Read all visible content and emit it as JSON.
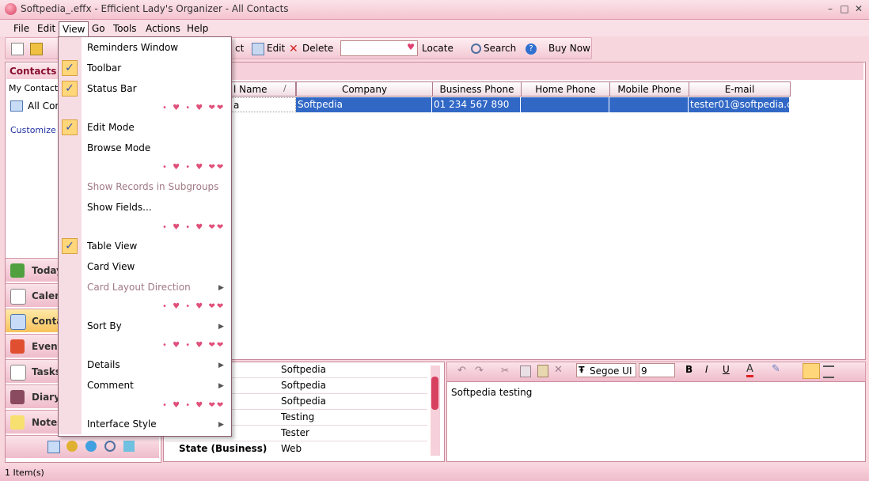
{
  "window": {
    "title": "Softpedia_.effx - Efficient Lady's Organizer - All Contacts",
    "minimize": "–",
    "maximize": "□",
    "close": "✕"
  },
  "menubar": [
    "File",
    "Edit",
    "View",
    "Go",
    "Tools",
    "Actions",
    "Help"
  ],
  "toolbar": {
    "contact_partial": "ct",
    "edit": "Edit",
    "delete": "Delete",
    "locate": "Locate",
    "search": "Search",
    "buy_now": "Buy Now"
  },
  "nav": {
    "title": "Contacts",
    "my_contacts": "My Contacts",
    "all_contacts": "All Con",
    "customize": "Customize C",
    "buttons": [
      "Today",
      "Calen",
      "Conta",
      "Event",
      "Tasks",
      "Diary",
      "Notes"
    ],
    "active": "Conta"
  },
  "grid": {
    "headers": [
      "l Name",
      "Company",
      "Business Phone",
      "Home Phone",
      "Mobile Phone",
      "E-mail"
    ],
    "row": [
      "a",
      "Softpedia",
      "01 234 567 890",
      "",
      "",
      "tester01@softpedia.com"
    ]
  },
  "details": {
    "values": [
      "Softpedia",
      "Softpedia",
      "Softpedia",
      "Testing",
      "Tester",
      "Web"
    ],
    "last_label": "State (Business)"
  },
  "notes": {
    "font": "Segoe UI",
    "size": "9",
    "text": "Softpedia testing"
  },
  "status": {
    "text": "1 Item(s)"
  },
  "view_menu": {
    "items": [
      {
        "label": "Reminders Window",
        "checked": false,
        "disabled": false
      },
      {
        "label": "Toolbar",
        "checked": true,
        "disabled": false
      },
      {
        "label": "Status Bar",
        "checked": true,
        "disabled": false
      },
      {
        "label": "Edit Mode",
        "checked": true,
        "disabled": false
      },
      {
        "label": "Browse Mode",
        "checked": false,
        "disabled": false
      },
      {
        "label": "Show Records in Subgroups",
        "checked": false,
        "disabled": true
      },
      {
        "label": "Show Fields...",
        "checked": false,
        "disabled": false
      },
      {
        "label": "Table View",
        "checked": true,
        "disabled": false
      },
      {
        "label": "Card View",
        "checked": false,
        "disabled": false
      },
      {
        "label": "Card Layout Direction",
        "checked": false,
        "disabled": true
      },
      {
        "label": "Sort By",
        "checked": false,
        "disabled": false
      },
      {
        "label": "Details",
        "checked": false,
        "disabled": false
      },
      {
        "label": "Comment",
        "checked": false,
        "disabled": false
      },
      {
        "label": "Interface Style",
        "checked": false,
        "disabled": false
      }
    ],
    "separator": "• ♥ • ♥ ❤❤"
  },
  "colors": {
    "accent": "#e04070",
    "selection": "#3168c6",
    "background": "#f8d6de"
  }
}
